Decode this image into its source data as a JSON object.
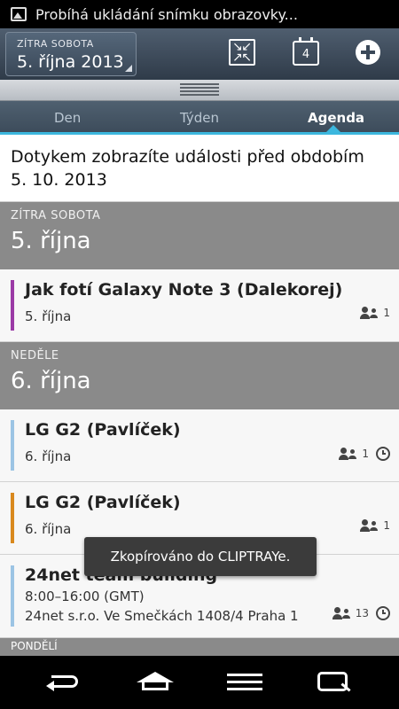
{
  "status_bar": {
    "notification_text": "Probíhá ukládání snímku obrazovky..."
  },
  "toolbar": {
    "date_small": "ZÍTRA SOBOTA",
    "date_big": "5. října 2013",
    "calendar_icon_day": "4"
  },
  "tabs": [
    {
      "label": "Den",
      "active": false
    },
    {
      "label": "Týden",
      "active": false
    },
    {
      "label": "Agenda",
      "active": true
    }
  ],
  "hint": {
    "line1": "Dotykem zobrazíte události před obdobím",
    "line2": "5. 10. 2013"
  },
  "days": [
    {
      "dow": "ZÍTRA SOBOTA",
      "date": "5. října",
      "events": [
        {
          "title": "Jak fotí Galaxy Note 3 (Dalekorej)",
          "sub1": "5. října",
          "attendees": "1",
          "color": "#9b3aa6",
          "alarm": false
        }
      ]
    },
    {
      "dow": "NEDĚLE",
      "date": "6. října",
      "events": [
        {
          "title": "LG G2 (Pavlíček)",
          "sub1": "6. října",
          "attendees": "1",
          "color": "#9cc4e4",
          "alarm": true
        },
        {
          "title": "LG G2 (Pavlíček)",
          "sub1": "6. října",
          "attendees": "1",
          "color": "#d9891e",
          "alarm": false
        },
        {
          "title": "24net team building",
          "sub1": "8:00–16:00 (GMT)",
          "sub2": "24net s.r.o. Ve Smečkách 1408/4 Praha 1",
          "attendees": "13",
          "color": "#9cc4e4",
          "alarm": true
        }
      ]
    }
  ],
  "next_day_peek": "PONDĚLÍ",
  "toast": {
    "text": "Zkopírováno do CLIPTRAYe."
  }
}
